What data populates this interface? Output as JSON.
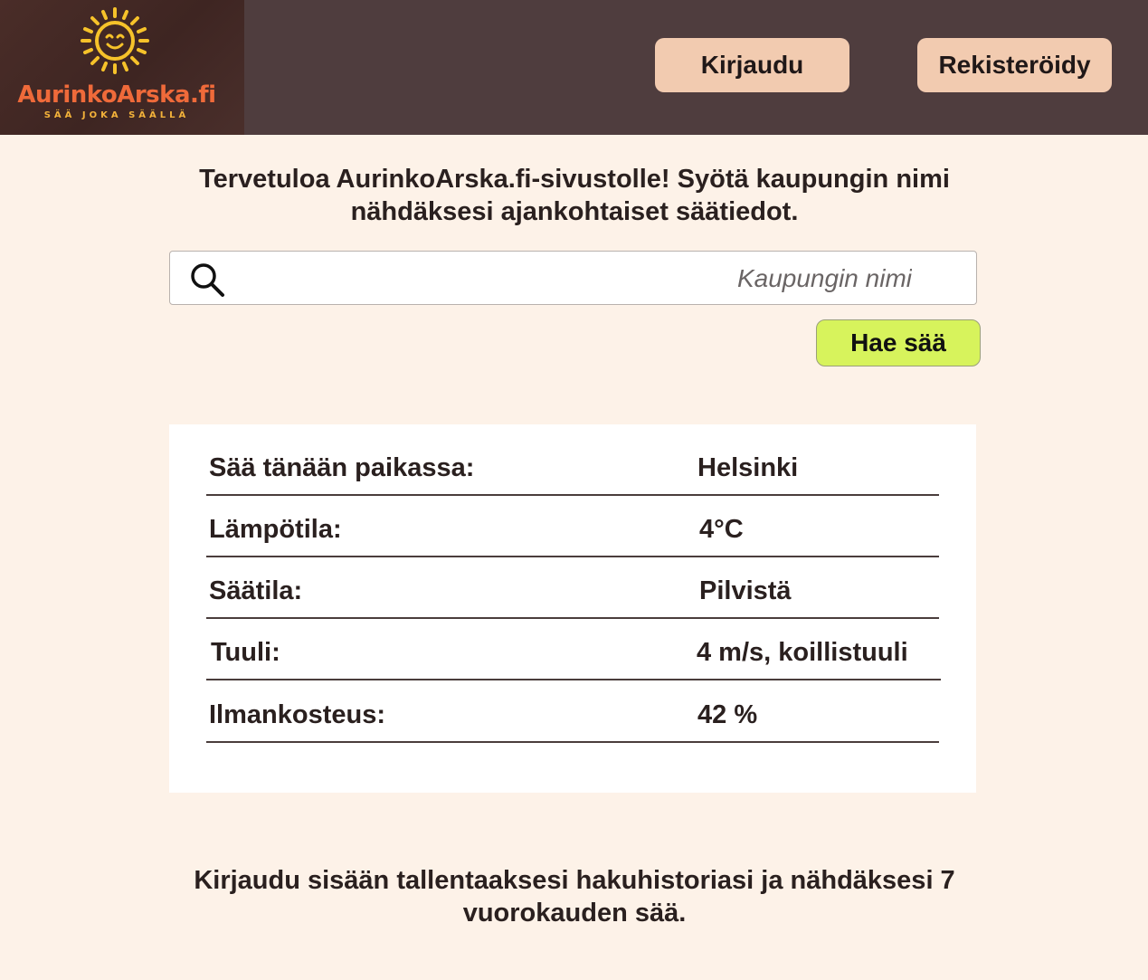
{
  "header": {
    "logo": {
      "name": "AurinkoArska.fi",
      "tagline": "SÄÄ JOKA SÄÄLLÄ",
      "icon": "smiling-sun-icon"
    },
    "login_label": "Kirjaudu",
    "register_label": "Rekisteröidy"
  },
  "main": {
    "welcome_text": "Tervetuloa AurinkoArska.fi-sivustolle! Syötä kaupungin nimi nähdäksesi ajankohtaiset säätiedot.",
    "search": {
      "icon": "search-icon",
      "placeholder": "Kaupungin nimi",
      "value": "",
      "button_label": "Hae sää"
    },
    "weather": {
      "rows": [
        {
          "label": "Sää tänään paikassa:",
          "value": "Helsinki"
        },
        {
          "label": "Lämpötila:",
          "value": "4°C"
        },
        {
          "label": "Säätila:",
          "value": "Pilvistä"
        },
        {
          "label": "Tuuli:",
          "value": "4 m/s, koillistuuli"
        },
        {
          "label": "Ilmankosteus:",
          "value": "42 %"
        }
      ]
    },
    "footer_note": "Kirjaudu sisään tallentaaksesi hakuhistoriasi ja nähdäksesi 7 vuorokauden sää."
  },
  "colors": {
    "header_bg": "#4f3d3e",
    "page_bg": "#fdf2e8",
    "header_button_bg": "#f2cbb0",
    "search_button_bg": "#d7f35c",
    "logo_text": "#ef6a3a",
    "logo_sun": "#f6c22a"
  }
}
